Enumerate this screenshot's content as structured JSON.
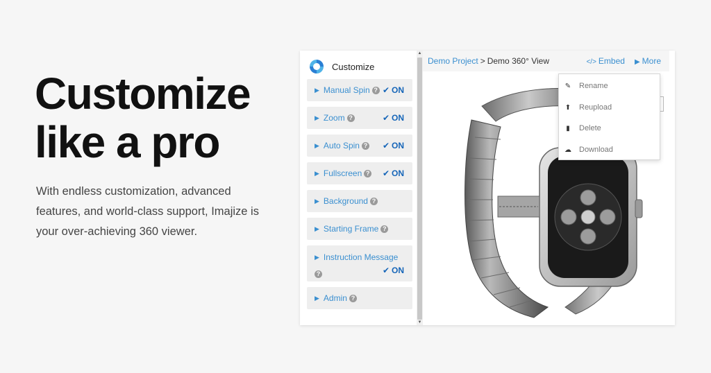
{
  "hero": {
    "title_line1": "Customize",
    "title_line2": "like a pro",
    "description": "With endless customization, advanced features, and world-class support, Imajize is your over-achieving 360 viewer."
  },
  "sidebar": {
    "title": "Customize",
    "options": [
      {
        "label": "Manual Spin",
        "status": "ON"
      },
      {
        "label": "Zoom",
        "status": "ON"
      },
      {
        "label": "Auto Spin",
        "status": "ON"
      },
      {
        "label": "Fullscreen",
        "status": "ON"
      },
      {
        "label": "Background",
        "status": ""
      },
      {
        "label": "Starting Frame",
        "status": ""
      },
      {
        "label": "Instruction Message",
        "status": "ON"
      },
      {
        "label": "Admin",
        "status": ""
      }
    ]
  },
  "breadcrumb": {
    "project": "Demo Project",
    "separator": ">",
    "current": "Demo 360° View"
  },
  "actions": {
    "embed": "Embed",
    "more": "More"
  },
  "dropdown": {
    "items": [
      {
        "label": "Rename",
        "icon": "pencil-icon"
      },
      {
        "label": "Reupload",
        "icon": "upload-arrow-icon"
      },
      {
        "label": "Delete",
        "icon": "trash-icon"
      },
      {
        "label": "Download",
        "icon": "cloud-download-icon"
      }
    ]
  },
  "colors": {
    "accent": "#3a8fd0",
    "on_status": "#1565b8",
    "background": "#f6f6f6"
  }
}
